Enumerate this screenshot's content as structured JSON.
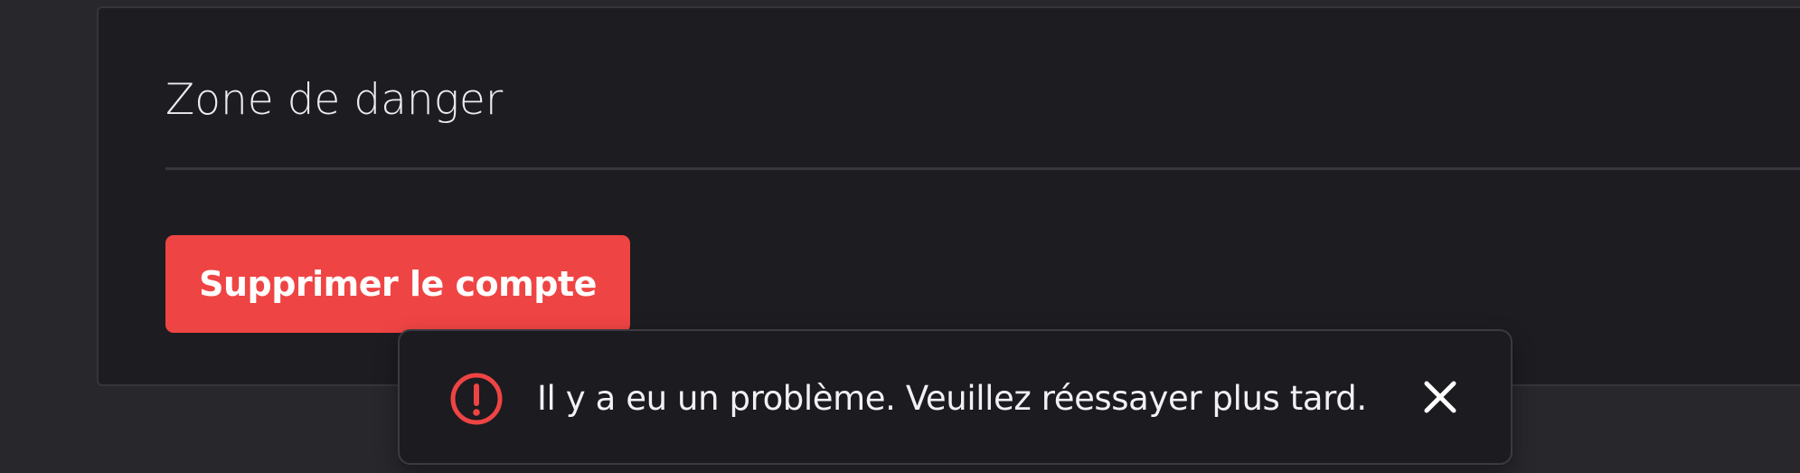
{
  "danger_zone": {
    "title": "Zone de danger",
    "delete_button_label": "Supprimer le compte"
  },
  "toast": {
    "message": "Il y a eu un problème. Veuillez réessayer plus tard.",
    "icon": "error-circle-icon",
    "close_icon": "close-icon"
  },
  "colors": {
    "page_background": "#28272c",
    "card_background": "#1d1c20",
    "danger_red": "#ef4444",
    "text_primary": "#ececef"
  }
}
